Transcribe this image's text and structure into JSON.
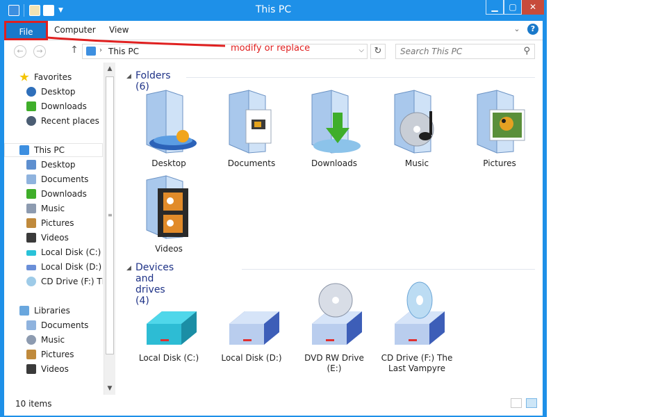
{
  "window": {
    "title": "This PC"
  },
  "caption_buttons": {
    "minimize": "▁",
    "maximize": "▢",
    "close": "✕"
  },
  "ribbon": {
    "file_label": "File",
    "tabs": [
      {
        "label": "Computer"
      },
      {
        "label": "View"
      }
    ],
    "help": "?"
  },
  "annotation": {
    "text": "modify or replace",
    "color": "#e02020"
  },
  "address": {
    "back": "←",
    "forward": "→",
    "up": "↑",
    "separator": "›",
    "path": "This PC",
    "dropdown": "⌵",
    "refresh": "↻"
  },
  "search": {
    "placeholder": "Search This PC",
    "icon": "⚲"
  },
  "navigation": {
    "favorites": {
      "label": "Favorites",
      "items": [
        {
          "label": "Desktop",
          "icon": "desktop-icon"
        },
        {
          "label": "Downloads",
          "icon": "downloads-icon"
        },
        {
          "label": "Recent places",
          "icon": "recent-places-icon"
        }
      ]
    },
    "this_pc": {
      "label": "This PC",
      "items": [
        {
          "label": "Desktop"
        },
        {
          "label": "Documents"
        },
        {
          "label": "Downloads"
        },
        {
          "label": "Music"
        },
        {
          "label": "Pictures"
        },
        {
          "label": "Videos"
        },
        {
          "label": "Local Disk (C:)"
        },
        {
          "label": "Local Disk (D:)"
        },
        {
          "label": "CD Drive (F:) The"
        }
      ]
    },
    "libraries": {
      "label": "Libraries",
      "items": [
        {
          "label": "Documents"
        },
        {
          "label": "Music"
        },
        {
          "label": "Pictures"
        },
        {
          "label": "Videos"
        }
      ]
    }
  },
  "folders_group": {
    "title": "Folders (6)",
    "items": [
      {
        "label": "Desktop"
      },
      {
        "label": "Documents"
      },
      {
        "label": "Downloads"
      },
      {
        "label": "Music"
      },
      {
        "label": "Pictures"
      },
      {
        "label": "Videos"
      }
    ]
  },
  "drives_group": {
    "title": "Devices and drives (4)",
    "items": [
      {
        "label": "Local Disk (C:)"
      },
      {
        "label": "Local Disk (D:)"
      },
      {
        "label": "DVD RW Drive (E:)"
      },
      {
        "label": "CD Drive (F:) The Last Vampyre"
      }
    ]
  },
  "status": {
    "text": "10 items"
  },
  "colors": {
    "accent": "#1e90e8",
    "file_tab": "#1979ca",
    "group_heading": "#1e3287",
    "close": "#c74b3b"
  }
}
